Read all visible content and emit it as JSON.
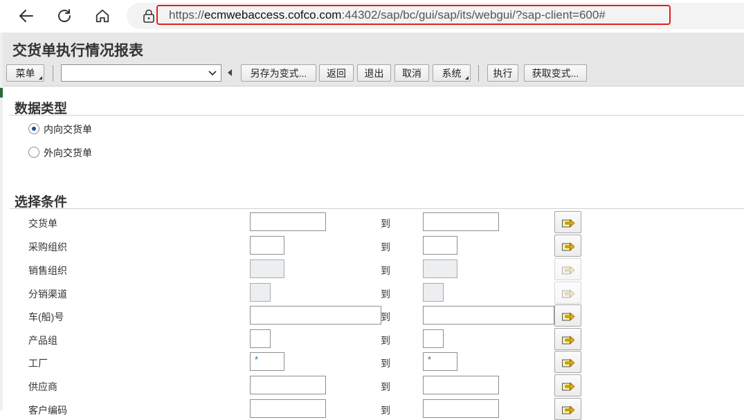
{
  "browser": {
    "url_scheme": "https://",
    "url_host": "ecmwebaccess.cofco.com",
    "url_rest": ":44302/sap/bc/gui/sap/its/webgui/?sap-client=600#"
  },
  "sap": {
    "title": "交货单执行情况报表",
    "toolbar": {
      "menu": "菜单",
      "variant_select_value": "",
      "save_as_variant": "另存为变式...",
      "back": "返回",
      "exit": "退出",
      "cancel": "取消",
      "system": "系统",
      "execute": "执行",
      "get_variant": "获取变式..."
    },
    "data_type": {
      "title": "数据类型",
      "options": [
        {
          "label": "内向交货单",
          "selected": true
        },
        {
          "label": "外向交货单",
          "selected": false
        }
      ]
    },
    "selection": {
      "title": "选择条件",
      "to_label": "到",
      "rows": [
        {
          "label": "交货单",
          "from": "",
          "to": "",
          "enabled": true
        },
        {
          "label": "采购组织",
          "from": "",
          "to": "",
          "enabled": true
        },
        {
          "label": "销售组织",
          "from": "",
          "to": "",
          "enabled": false
        },
        {
          "label": "分销渠道",
          "from": "",
          "to": "",
          "enabled": false
        },
        {
          "label": "车(船)号",
          "from": "",
          "to": "",
          "enabled": true
        },
        {
          "label": "产品组",
          "from": "",
          "to": "",
          "enabled": true
        },
        {
          "label": "工厂",
          "from": "*",
          "to": "*",
          "enabled": true
        },
        {
          "label": "供应商",
          "from": "",
          "to": "",
          "enabled": true
        },
        {
          "label": "客户编码",
          "from": "",
          "to": "",
          "enabled": true
        }
      ]
    }
  },
  "colors": {
    "url_highlight": "#e41e1e",
    "toolbar_bg": "#e7e7e7",
    "radio_selected": "#1a4f9c",
    "multi_select_arrow": "#e8a800"
  },
  "icons": {
    "back": "arrow-left-icon",
    "reload": "reload-icon",
    "home": "home-icon",
    "lock": "lock-icon",
    "multi_select": "multiple-selection-arrow-icon",
    "dropdown": "chevron-down-icon"
  }
}
